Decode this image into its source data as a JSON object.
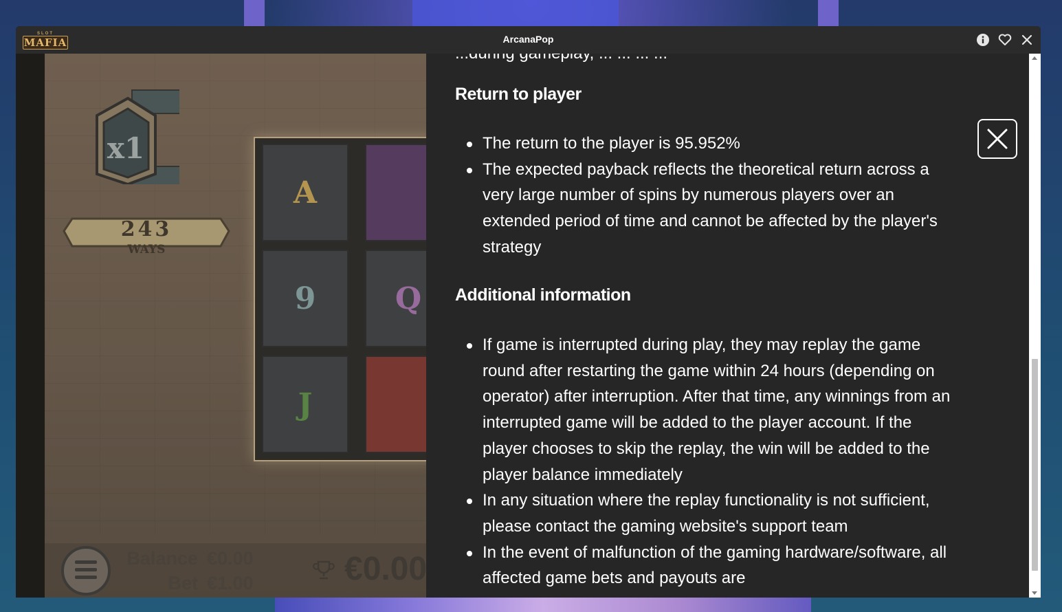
{
  "window": {
    "title": "ArcanaPop",
    "logo_small": "SLOT",
    "logo_main": "MAFIA",
    "icons": [
      "info-icon",
      "heart-icon",
      "close-icon"
    ]
  },
  "game": {
    "multiplier": "x1",
    "ways_count": "243",
    "ways_label": "WAYS",
    "reel_symbols": [
      "A",
      "9",
      "J",
      "",
      "Q",
      ""
    ],
    "balance_label": "Balance",
    "balance_value": "€0.00",
    "bet_label": "Bet",
    "bet_value": "€1.00",
    "win_value": "€0.00"
  },
  "info": {
    "cut_text": "...during gameplay, ... ... ... ...",
    "sections": [
      {
        "heading": "Return to player",
        "items": [
          "The return to the player is 95.952%",
          "The expected payback reflects the theoretical return across a very large number of spins by numerous players over an extended period of time and cannot be affected by the player's strategy"
        ]
      },
      {
        "heading": "Additional information",
        "items": [
          "If game is interrupted during play, they may replay the game round after restarting the game within 24 hours (depending on operator) after interruption. After that time, any winnings from an interrupted game will be added to the player account. If the player chooses to skip the replay, the win will be added to the player balance immediately",
          "In any situation where the replay functionality is not sufficient, please contact the gaming website's support team",
          "In the event of malfunction of the gaming hardware/software, all affected game bets and payouts are"
        ]
      }
    ]
  },
  "colors": {
    "panel_bg": "#262626",
    "titlebar_bg": "#2b2b2b",
    "text": "#ffffff"
  }
}
